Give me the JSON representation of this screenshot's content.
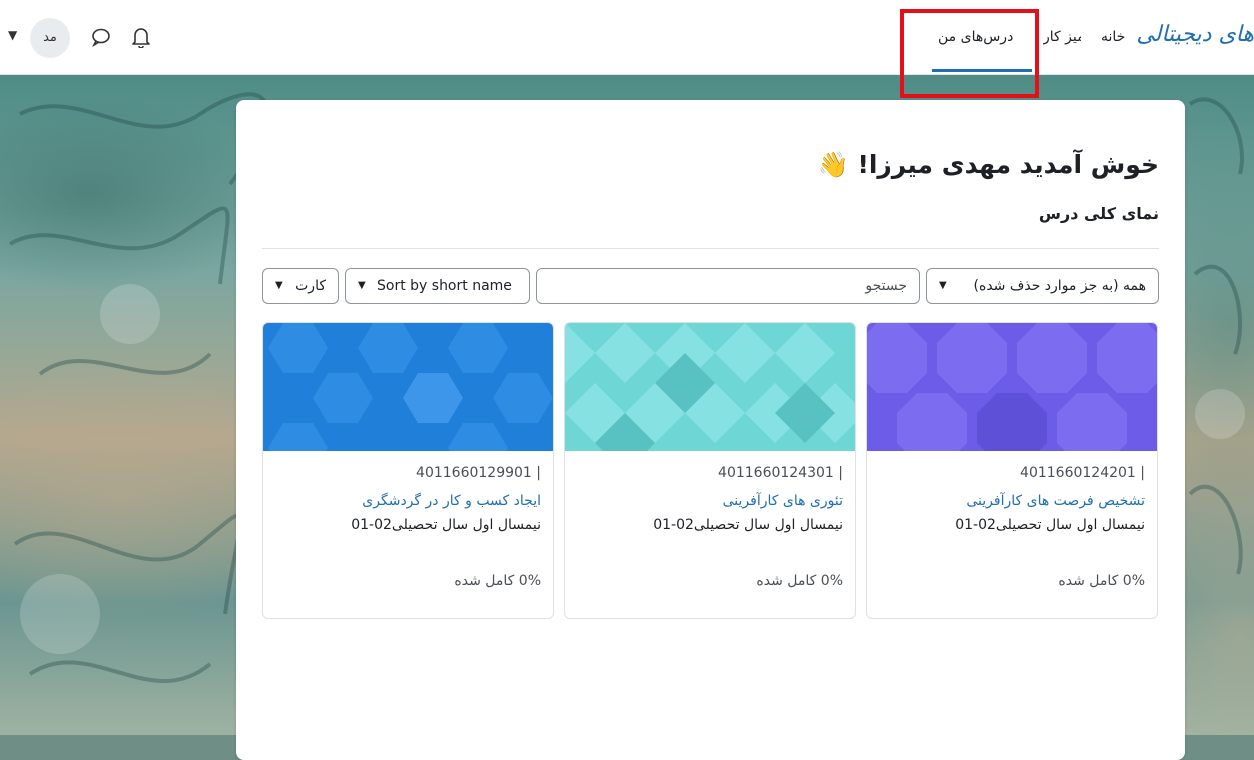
{
  "navbar": {
    "brand": "های دیجیتالی",
    "links": {
      "home": "خانه",
      "dashboard": "میز کار",
      "my_courses": "درس‌های من"
    },
    "user_initials": "مد"
  },
  "main": {
    "welcome": "خوش آمدید مهدی میرزا!",
    "wave_emoji": "👋",
    "section_title": "نمای کلی درس",
    "filter_value": "همه (به جز موارد حذف شده)",
    "search_placeholder": "جستجو",
    "sort_value": "Sort by short name",
    "view_value": "کارت"
  },
  "courses": [
    {
      "code": "| 4011660124201",
      "name": "تشخیص فرصت های کارآفرینی",
      "term": "نیمسال اول سال تحصیلی02-01",
      "progress": "0% کامل شده",
      "color": "#6c5ce7"
    },
    {
      "code": "| 4011660124301",
      "name": "تئوری های کارآفرینی",
      "term": "نیمسال اول سال تحصیلی02-01",
      "progress": "0% کامل شده",
      "color": "#6fd6d6"
    },
    {
      "code": "| 4011660129901",
      "name": "ایجاد کسب و کار در گردشگری",
      "term": "نیمسال اول سال تحصیلی02-01",
      "progress": "0% کامل شده",
      "color": "#1f7fd9"
    }
  ]
}
